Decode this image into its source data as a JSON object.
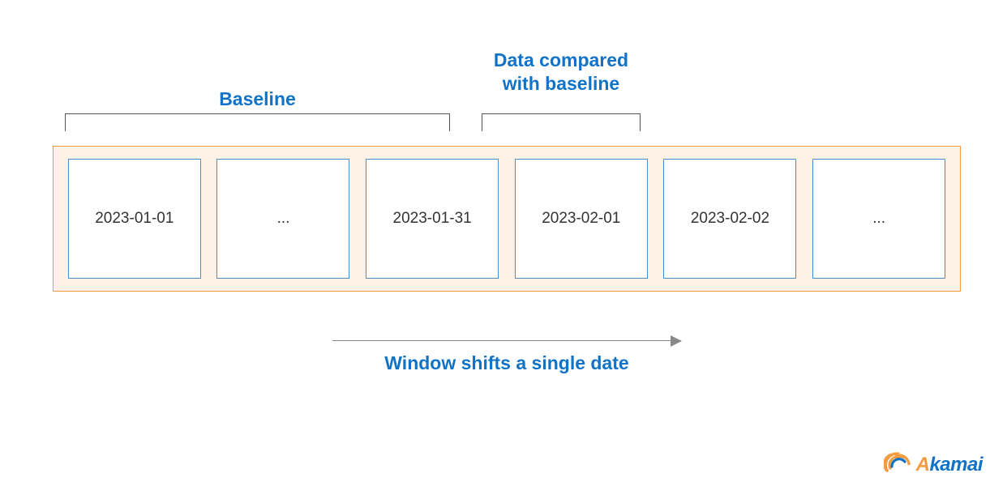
{
  "labels": {
    "baseline": "Baseline",
    "compared": "Data compared with baseline",
    "caption": "Window shifts a single date"
  },
  "boxes": {
    "b0": "2023-01-01",
    "b1": "...",
    "b2": "2023-01-31",
    "b3": "2023-02-01",
    "b4": "2023-02-02",
    "b5": "..."
  },
  "logo": {
    "part1": "A",
    "part2": "kamai"
  }
}
